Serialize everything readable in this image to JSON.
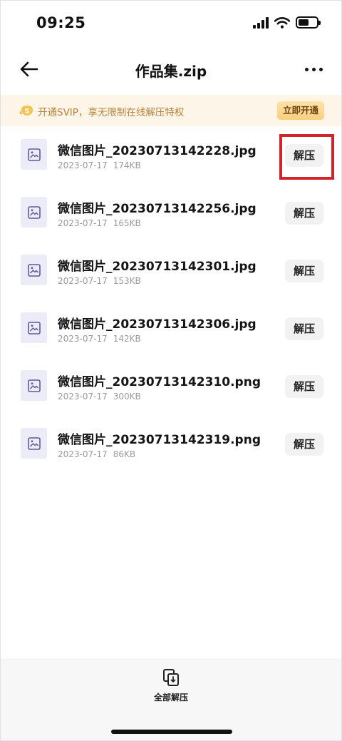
{
  "status_bar": {
    "time": "09:25",
    "battery_level": 0.6
  },
  "header": {
    "title": "作品集.zip"
  },
  "vip_banner": {
    "text": "开通SVIP，享无限制在线解压特权",
    "button_label": "立即开通"
  },
  "files": [
    {
      "name": "微信图片_20230713142228.jpg",
      "date": "2023-07-17",
      "size": "174KB",
      "action": "解压"
    },
    {
      "name": "微信图片_20230713142256.jpg",
      "date": "2023-07-17",
      "size": "165KB",
      "action": "解压"
    },
    {
      "name": "微信图片_20230713142301.jpg",
      "date": "2023-07-17",
      "size": "153KB",
      "action": "解压"
    },
    {
      "name": "微信图片_20230713142306.jpg",
      "date": "2023-07-17",
      "size": "142KB",
      "action": "解压"
    },
    {
      "name": "微信图片_20230713142310.png",
      "date": "2023-07-17",
      "size": "300KB",
      "action": "解压"
    },
    {
      "name": "微信图片_20230713142319.png",
      "date": "2023-07-17",
      "size": "86KB",
      "action": "解压"
    }
  ],
  "bottom_bar": {
    "extract_all_label": "全部解压"
  },
  "colors": {
    "accent_highlight": "#d2232a",
    "vip_text": "#b9823c",
    "thumb_bg": "#ecebf8",
    "thumb_icon": "#5d5a9c"
  },
  "icons": {
    "back": "arrow-left-icon",
    "more": "more-dots-icon",
    "vip": "svip-coin-icon",
    "file": "image-file-icon",
    "extract_all": "extract-all-icon"
  }
}
